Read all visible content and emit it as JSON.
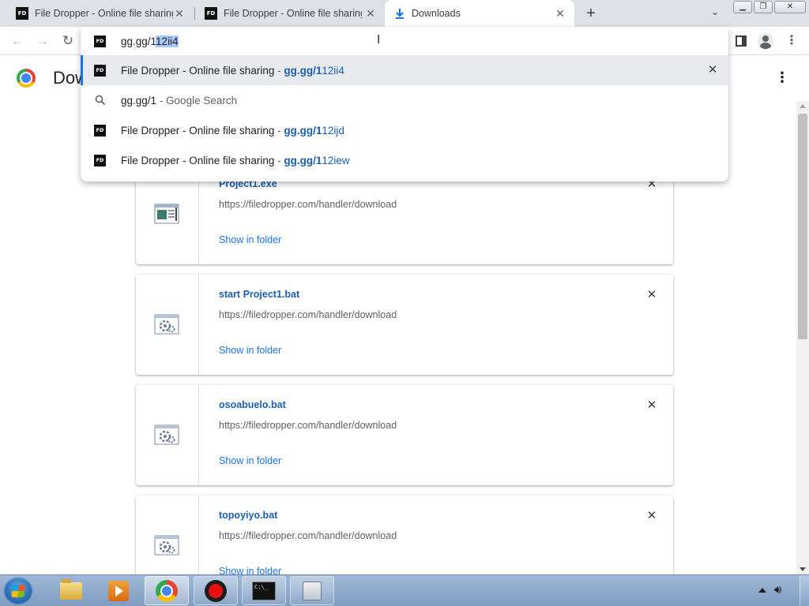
{
  "tabs": [
    {
      "favicon": "FD",
      "title": "File Dropper - Online file sharing",
      "active": false
    },
    {
      "favicon": "FD",
      "title": "File Dropper - Online file sharing",
      "active": false
    },
    {
      "favicon": "download-icon",
      "title": "Downloads",
      "active": true
    }
  ],
  "omnibox": {
    "favicon": "FD",
    "typed": "gg.gg/1",
    "autocomplete_selected": "12ii4",
    "suggestions": [
      {
        "kind": "page",
        "favicon": "FD",
        "title": "File Dropper - Online file sharing",
        "sep": " - ",
        "url_bold": "gg.gg/1",
        "url_rest": "12ii4",
        "highlighted": true,
        "has_remove": true
      },
      {
        "kind": "search",
        "query": "gg.gg/1",
        "sep": " - ",
        "engine_text": "Google Search",
        "highlighted": false
      },
      {
        "kind": "page",
        "favicon": "FD",
        "title": "File Dropper - Online file sharing",
        "sep": " - ",
        "url_bold": "gg.gg/1",
        "url_rest": "12ijd",
        "highlighted": false
      },
      {
        "kind": "page",
        "favicon": "FD",
        "title": "File Dropper - Online file sharing",
        "sep": " - ",
        "url_bold": "gg.gg/1",
        "url_rest": "12iew",
        "highlighted": false
      }
    ]
  },
  "page": {
    "title": "Dow",
    "downloads": [
      {
        "name": "Project1.exe",
        "url": "https://filedropper.com/handler/download",
        "action": "Show in folder",
        "icon": "exe-file-icon"
      },
      {
        "name": "start Project1.bat",
        "url": "https://filedropper.com/handler/download",
        "action": "Show in folder",
        "icon": "bat-file-icon"
      },
      {
        "name": "osoabuelo.bat",
        "url": "https://filedropper.com/handler/download",
        "action": "Show in folder",
        "icon": "bat-file-icon"
      },
      {
        "name": "topoyiyo.bat",
        "url": "https://filedropper.com/handler/download",
        "action": "Show in folder",
        "icon": "bat-file-icon"
      }
    ]
  },
  "taskbar": {
    "apps": [
      "folder-icon",
      "media-player-icon",
      "chrome-icon",
      "recorder-icon",
      "cmd-icon",
      "explorer-icon"
    ],
    "cmd_label": "C:\\_"
  },
  "colors": {
    "link": "#1a5fb4",
    "accent": "#1a73e8",
    "selection": "#a8c7fa",
    "tabstrip": "#dee1e6"
  }
}
